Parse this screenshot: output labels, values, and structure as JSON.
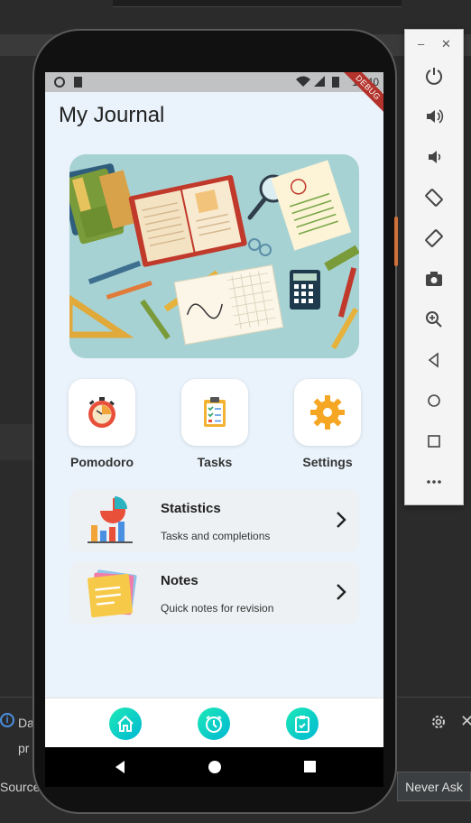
{
  "app": {
    "title": "My Journal",
    "debug_banner": "DEBUG",
    "status_time": "12:40"
  },
  "quick_actions": [
    {
      "label": "Pomodoro",
      "icon": "pomodoro-timer-icon"
    },
    {
      "label": "Tasks",
      "icon": "clipboard-tasks-icon"
    },
    {
      "label": "Settings",
      "icon": "gear-icon"
    }
  ],
  "cards": [
    {
      "title": "Statistics",
      "subtitle": "Tasks and completions",
      "icon": "statistics-chart-icon"
    },
    {
      "title": "Notes",
      "subtitle": "Quick notes for revision",
      "icon": "sticky-notes-icon"
    }
  ],
  "bottom_nav": [
    {
      "icon": "home-icon"
    },
    {
      "icon": "timer-icon"
    },
    {
      "icon": "clipboard-icon"
    }
  ],
  "ide": {
    "notif_line1": "Da",
    "notif_line2": "pr",
    "source_label": "Source:",
    "never_ask": "Never Ask"
  },
  "colors": {
    "screen_bg": "#eaf3fb",
    "accent_gradient_start": "#1de9b6",
    "accent_gradient_end": "#00b8d4",
    "debug_red": "#b3332c"
  }
}
